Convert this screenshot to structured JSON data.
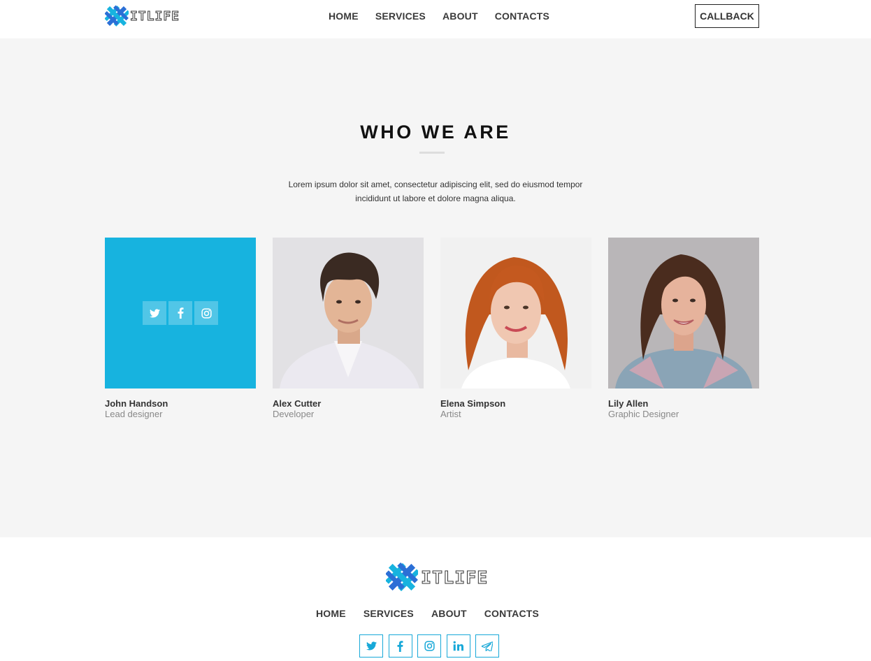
{
  "brand": {
    "name": "ITLIFE",
    "accent": "#17b3df",
    "accent_dark": "#2b6fd6"
  },
  "header": {
    "nav": [
      "HOME",
      "SERVICES",
      "ABOUT",
      "CONTACTS"
    ],
    "callback_label": "CALLBACK"
  },
  "section": {
    "title": "WHO WE ARE",
    "description": "Lorem ipsum dolor sit amet, consectetur adipiscing elit, sed do eiusmod tempor incididunt ut labore et dolore magna aliqua."
  },
  "team": [
    {
      "name": "John Handson",
      "role": "Lead designer",
      "hovered": true,
      "social": [
        "twitter-icon",
        "facebook-icon",
        "instagram-icon"
      ]
    },
    {
      "name": "Alex Cutter",
      "role": "Developer",
      "photo": "photo of a young man with dark hair"
    },
    {
      "name": "Elena Simpson",
      "role": "Artist",
      "photo": "photo of a woman with red hair"
    },
    {
      "name": "Lily Allen",
      "role": "Graphic Designer",
      "photo": "photo of a woman with long brown hair"
    }
  ],
  "footer": {
    "nav": [
      "HOME",
      "SERVICES",
      "ABOUT",
      "CONTACTS"
    ],
    "social": [
      "twitter-icon",
      "facebook-icon",
      "instagram-icon",
      "linkedin-icon",
      "telegram-icon"
    ]
  }
}
